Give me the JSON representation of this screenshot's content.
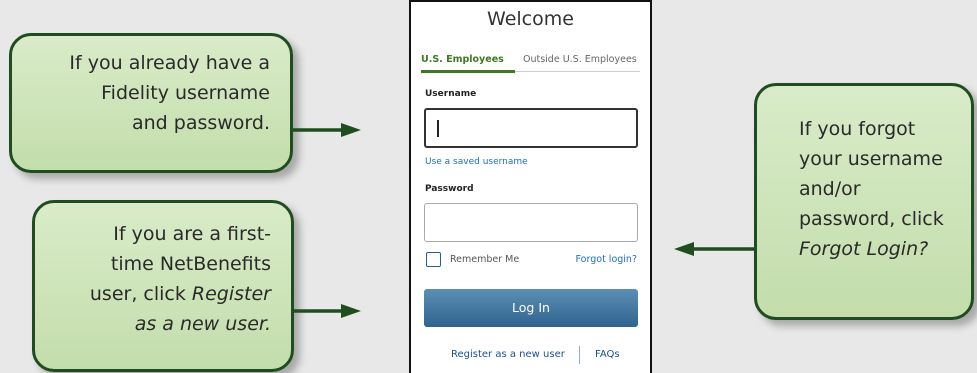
{
  "callouts": {
    "existing": [
      "If you already have a",
      "Fidelity username",
      "and password."
    ],
    "register": {
      "line1": "If you are a first-",
      "line2": "time NetBenefits",
      "line3_prefix": "user, click ",
      "line3_italic": "Register",
      "line4_italic": "as a new user."
    },
    "forgot": {
      "line1": "If you forgot",
      "line2": "your username",
      "line3": "and/or",
      "line4": "password, click",
      "line5_italic": "Forgot Login?"
    }
  },
  "login": {
    "title": "Welcome",
    "tabs": [
      "U.S. Employees",
      "Outside U.S. Employees"
    ],
    "active_tab": "U.S. Employees",
    "username_label": "Username",
    "username_value": "",
    "saved_username_link": "Use a saved username",
    "password_label": "Password",
    "password_value": "",
    "remember_me": "Remember Me",
    "remember_checked": false,
    "forgot_login": "Forgot login?",
    "login_button": "Log In",
    "register_link": "Register as a new user",
    "faqs_link": "FAQs"
  },
  "colors": {
    "callout_fill": "#c9e2b3",
    "callout_border": "#1f4d1f",
    "arrow": "#1f4d1f",
    "tab_active": "#3f7a22",
    "link": "#1e6dbf",
    "button": "#3b6f99"
  },
  "icons": [
    "right-arrow-icon",
    "left-arrow-icon",
    "checkbox-icon"
  ]
}
